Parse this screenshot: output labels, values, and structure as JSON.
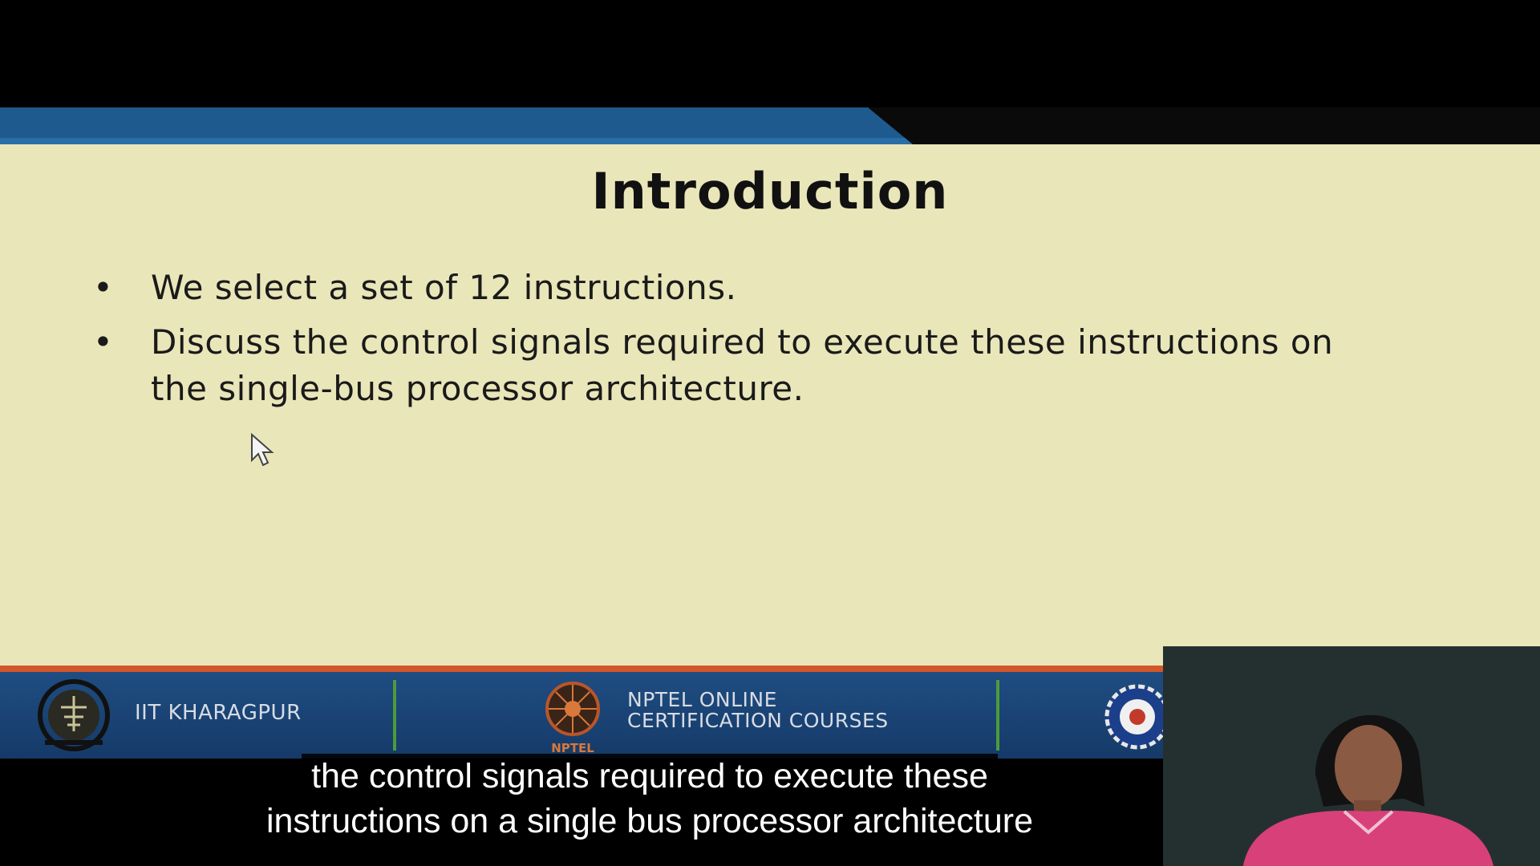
{
  "slide": {
    "title": "Introduction",
    "bullets": [
      "We select a set of 12 instructions.",
      "Discuss the control signals required to execute these instructions on the single-bus processor architecture."
    ],
    "bullet_symbol": "•"
  },
  "footer": {
    "institute": "IIT KHARAGPUR",
    "program_line1": "NPTEL ONLINE",
    "program_line2": "CERTIFICATION COURSES",
    "nptel_logo_text": "NPTEL"
  },
  "captions": {
    "line1": "the control signals required to execute these",
    "line2": "instructions on a single bus processor architecture"
  },
  "colors": {
    "slide_background": "#e9e6b9",
    "header_blue": "#1e5a8e",
    "footer_blue": "#1f4d82",
    "accent_orange": "#d2572a",
    "divider_green": "#4f9a3a"
  },
  "icons": {
    "cursor": "mouse-pointer-icon",
    "iit_logo": "iit-kharagpur-emblem-icon",
    "nptel_logo": "nptel-logo-icon",
    "partner_logo": "gear-emblem-icon"
  }
}
